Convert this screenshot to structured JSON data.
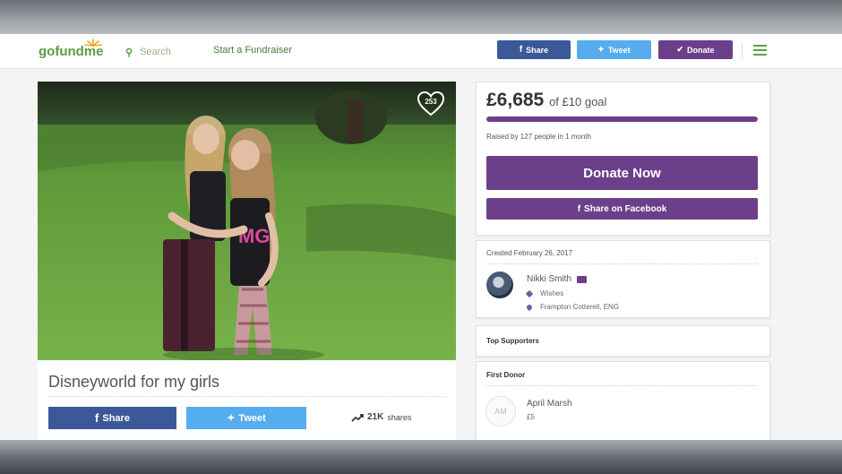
{
  "nav": {
    "logo": "gofundme",
    "search_placeholder": "Search",
    "start_link": "Start a Fundraiser",
    "share_label": "Share",
    "tweet_label": "Tweet",
    "donate_label": "Donate"
  },
  "campaign": {
    "hearts": "253",
    "title": "Disneyworld for my girls",
    "share_label": "Share",
    "tweet_label": "Tweet",
    "shares_count": "21K",
    "shares_label": "shares"
  },
  "fundraising": {
    "raised": "£6,685",
    "goal_text": "of £10 goal",
    "progress_fraction": 1.0,
    "raised_by": "Raised by 127 people in 1 month",
    "donate_now": "Donate Now",
    "share_facebook": "Share on Facebook"
  },
  "organizer": {
    "created": "Created February 26, 2017",
    "name": "Nikki Smith",
    "category": "Wishes",
    "location": "Frampton Cotterell, ENG"
  },
  "supporters": {
    "top_heading": "Top Supporters",
    "first_heading": "First Donor",
    "donor_initials": "AM",
    "donor_name": "April Marsh",
    "donor_amount": "£5"
  },
  "colors": {
    "brand_green": "#5a9e43",
    "donate_purple": "#6c3f8a",
    "facebook_blue": "#3b5998",
    "twitter_blue": "#55acee"
  }
}
